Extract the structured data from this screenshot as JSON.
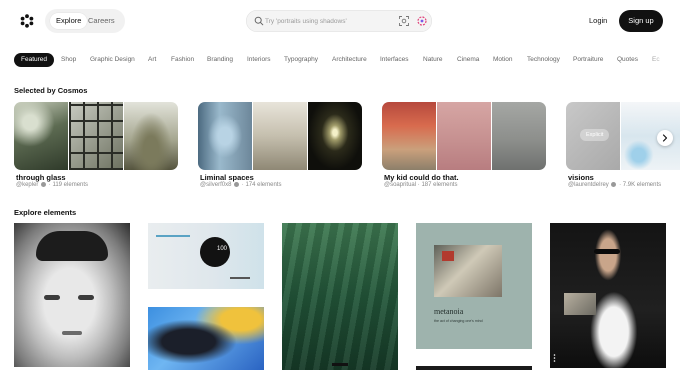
{
  "header": {
    "nav": {
      "explore": "Explore",
      "careers": "Careers"
    },
    "search": {
      "placeholder": "Try 'portraits using shadows'"
    },
    "login": "Login",
    "signup": "Sign up"
  },
  "categories": [
    {
      "label": "Featured",
      "active": true
    },
    {
      "label": "Shop"
    },
    {
      "label": "Graphic Design"
    },
    {
      "label": "Art"
    },
    {
      "label": "Fashion"
    },
    {
      "label": "Branding"
    },
    {
      "label": "Interiors"
    },
    {
      "label": "Typography"
    },
    {
      "label": "Architecture"
    },
    {
      "label": "Interfaces"
    },
    {
      "label": "Nature"
    },
    {
      "label": "Cinema"
    },
    {
      "label": "Motion"
    },
    {
      "label": "Technology"
    },
    {
      "label": "Portraiture"
    },
    {
      "label": "Quotes"
    },
    {
      "label": "Ec"
    }
  ],
  "selected": {
    "title": "Selected by Cosmos",
    "collections": [
      {
        "title": "through glass",
        "user": "@kepler",
        "count": "119 elements"
      },
      {
        "title": "Liminal spaces",
        "user": "@silverf0x8",
        "count": "174 elements"
      },
      {
        "title": "My kid could do that.",
        "user": "@soapritual",
        "count": "187 elements"
      },
      {
        "title": "visions",
        "user": "@laurentdelrey",
        "count": "7.9K elements",
        "badge": "Explicit"
      }
    ]
  },
  "explore": {
    "title": "Explore elements",
    "cards": {
      "c2_number": "100",
      "c4_title": "metanoia",
      "c4_caption": "the act of changing one's mind"
    }
  },
  "colors": {
    "accent": "#111111",
    "muted": "#888888"
  }
}
